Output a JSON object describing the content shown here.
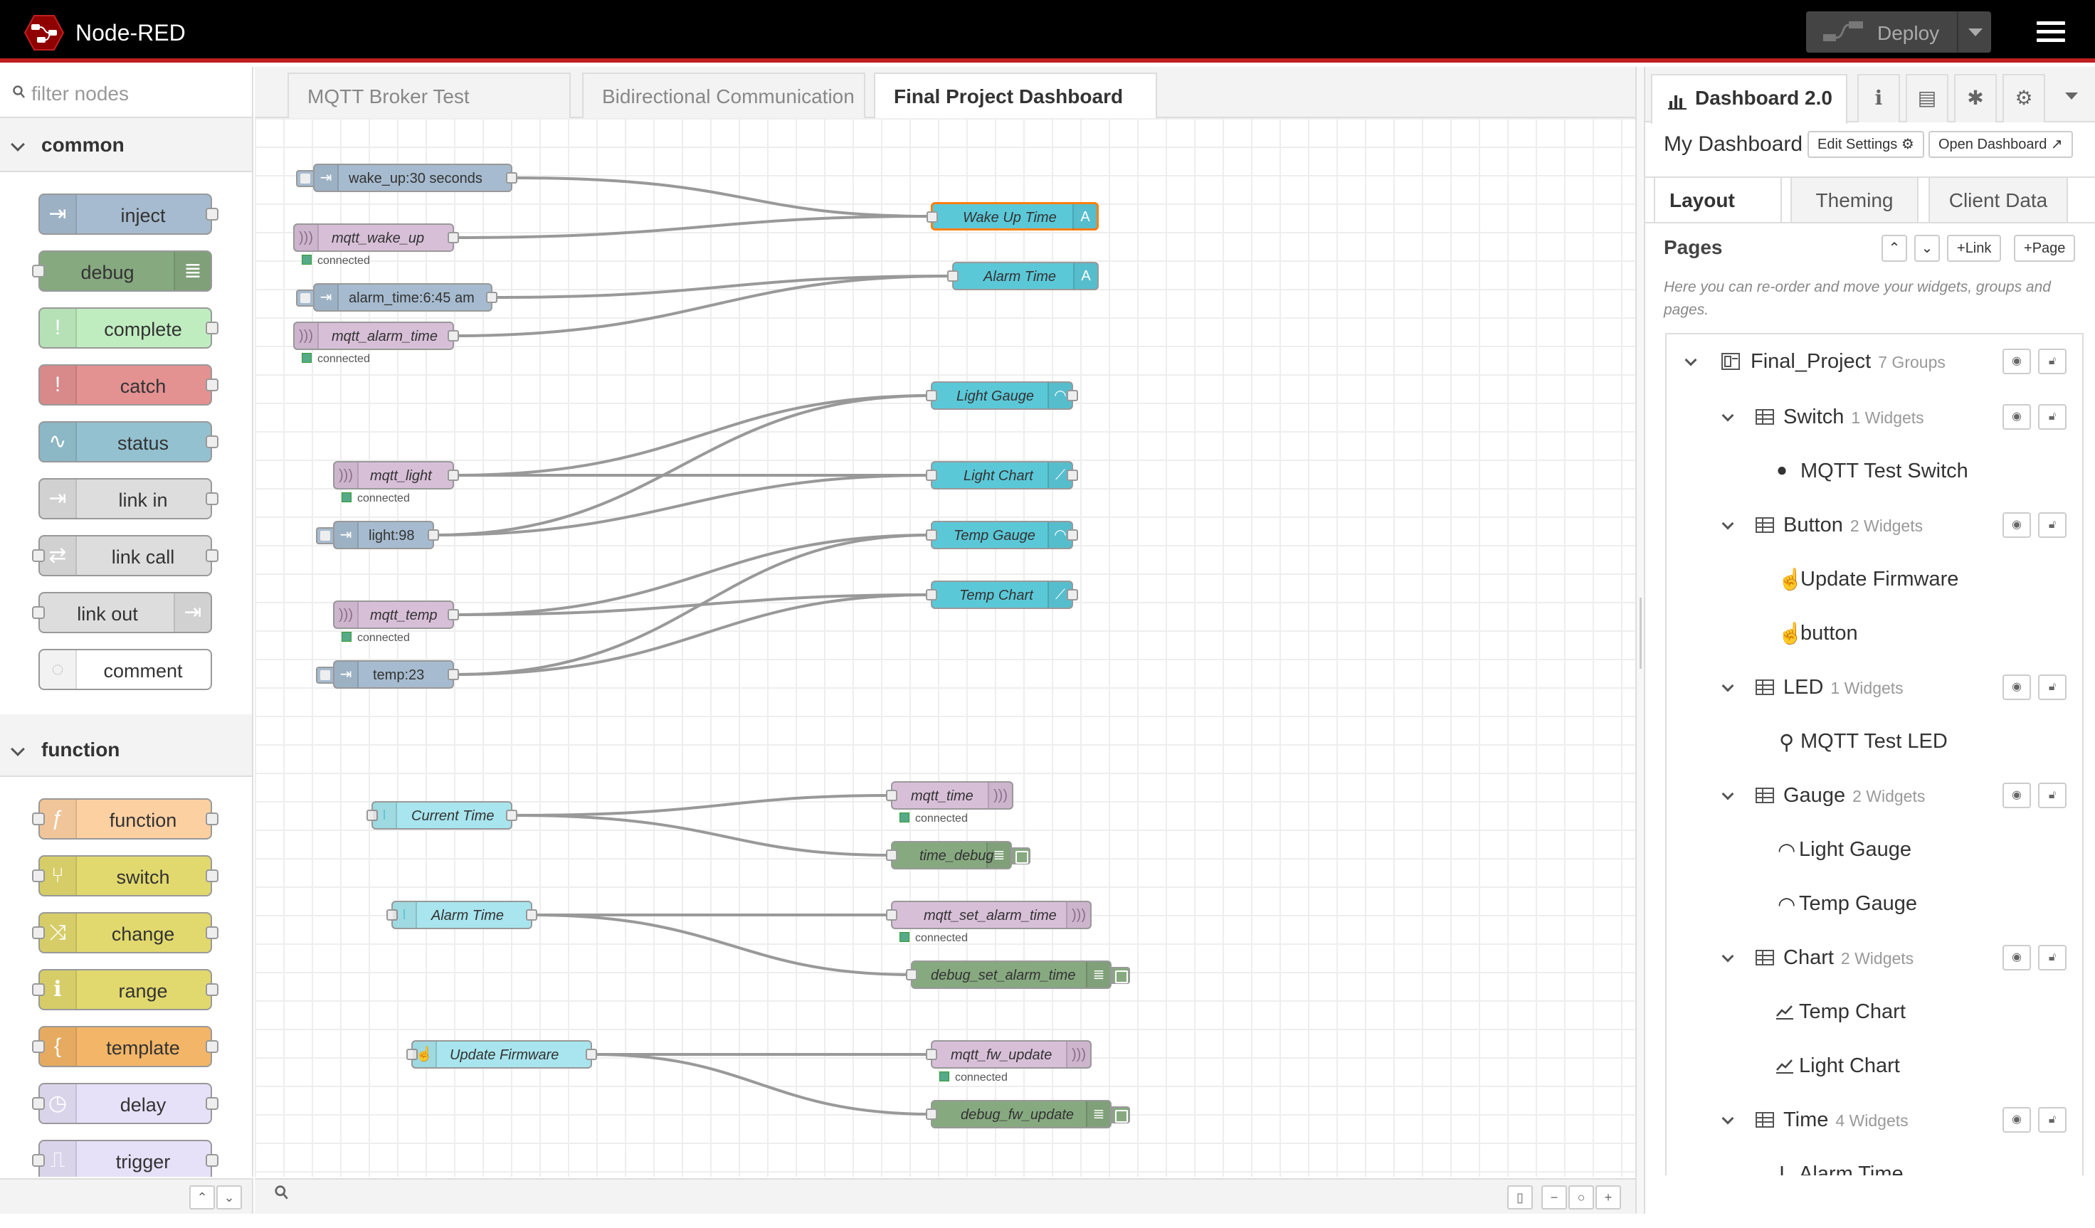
{
  "app": {
    "title": "Node-RED",
    "deploy_label": "Deploy"
  },
  "palette": {
    "search_placeholder": "filter nodes",
    "categories": [
      {
        "label": "common",
        "nodes": [
          "inject",
          "debug",
          "complete",
          "catch",
          "status",
          "link in",
          "link call",
          "link out",
          "comment"
        ]
      },
      {
        "label": "function",
        "nodes": [
          "function",
          "switch",
          "change",
          "range",
          "template",
          "delay",
          "trigger"
        ]
      }
    ]
  },
  "workspace": {
    "tabs": [
      "MQTT Broker Test",
      "Bidirectional Communication",
      "Final Project Dashboard"
    ],
    "active_tab": "Final Project Dashboard",
    "nodes": {
      "n1": "wake_up:30 seconds",
      "n2": "mqtt_wake_up",
      "n3": "alarm_time:6:45 am",
      "n4": "mqtt_alarm_time",
      "n5": "Wake Up Time",
      "n6": "Alarm Time",
      "n7": "mqtt_light",
      "n8": "light:98",
      "n9": "Light Gauge",
      "n10": "Light Chart",
      "n11": "Temp Gauge",
      "n12": "mqtt_temp",
      "n13": "Temp Chart",
      "n14": "temp:23",
      "n15": "Current Time",
      "n16": "mqtt_time",
      "n17": "time_debug",
      "n18": "Alarm Time",
      "n19": "mqtt_set_alarm_time",
      "n20": "debug_set_alarm_time",
      "n21": "Update Firmware",
      "n22": "mqtt_fw_update",
      "n23": "debug_fw_update"
    },
    "status_connected": "connected"
  },
  "sidebar": {
    "active_tab": "Dashboard 2.0",
    "dashboard_name": "My Dashboard",
    "edit_settings": "Edit Settings",
    "open_dashboard": "Open Dashboard",
    "tabs": [
      "Layout",
      "Theming",
      "Client Data"
    ],
    "pages_title": "Pages",
    "link_btn": "Link",
    "page_btn": "Page",
    "help_text": "Here you can re-order and move your widgets, groups and pages.",
    "tree": {
      "page": {
        "label": "Final_Project",
        "count": "7 Groups"
      },
      "groups": [
        {
          "label": "Switch",
          "count": "1 Widgets",
          "widgets": [
            "MQTT Test Switch"
          ]
        },
        {
          "label": "Button",
          "count": "2 Widgets",
          "widgets": [
            "Update Firmware",
            "button"
          ]
        },
        {
          "label": "LED",
          "count": "1 Widgets",
          "widgets": [
            "MQTT Test LED"
          ]
        },
        {
          "label": "Gauge",
          "count": "2 Widgets",
          "widgets": [
            "Light Gauge",
            "Temp Gauge"
          ]
        },
        {
          "label": "Chart",
          "count": "2 Widgets",
          "widgets": [
            "Temp Chart",
            "Light Chart"
          ]
        },
        {
          "label": "Time",
          "count": "4 Widgets",
          "widgets": [
            "Alarm Time"
          ]
        }
      ]
    }
  },
  "colors": {
    "inject": "#a6bbcf",
    "mqtt": "#d8bfd8",
    "ui_text": "#5bc8d8",
    "debug": "#87a980",
    "complete": "#c0edc0",
    "catch": "#e49191",
    "function": "#fdd0a2",
    "switch": "#e2d96e",
    "template": "#f3b567",
    "delay": "#e6e0f8",
    "ui_input": "#a8e5ee"
  }
}
